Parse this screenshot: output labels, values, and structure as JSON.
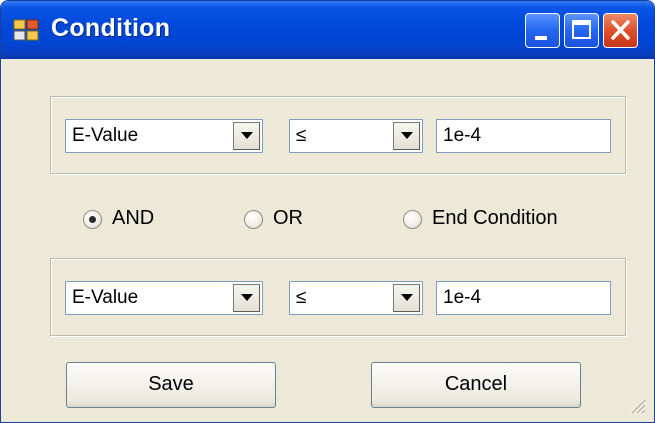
{
  "window": {
    "title": "Condition"
  },
  "row1": {
    "field": "E-Value",
    "operator": "≤",
    "value": "1e-4"
  },
  "logic": {
    "options": [
      {
        "label": "AND",
        "selected": true
      },
      {
        "label": "OR",
        "selected": false
      },
      {
        "label": "End Condition",
        "selected": false
      }
    ]
  },
  "row2": {
    "field": "E-Value",
    "operator": "≤",
    "value": "1e-4"
  },
  "buttons": {
    "save": "Save",
    "cancel": "Cancel"
  },
  "icons": {
    "app": "app-icon",
    "minimize": "minimize-icon",
    "maximize": "maximize-icon",
    "close": "close-icon",
    "dropdown": "chevron-down-icon",
    "resize": "resize-grip-icon"
  },
  "colors": {
    "titlebar": "#0046d5",
    "client_background": "#ece9d8",
    "close_button": "#e0502a"
  }
}
